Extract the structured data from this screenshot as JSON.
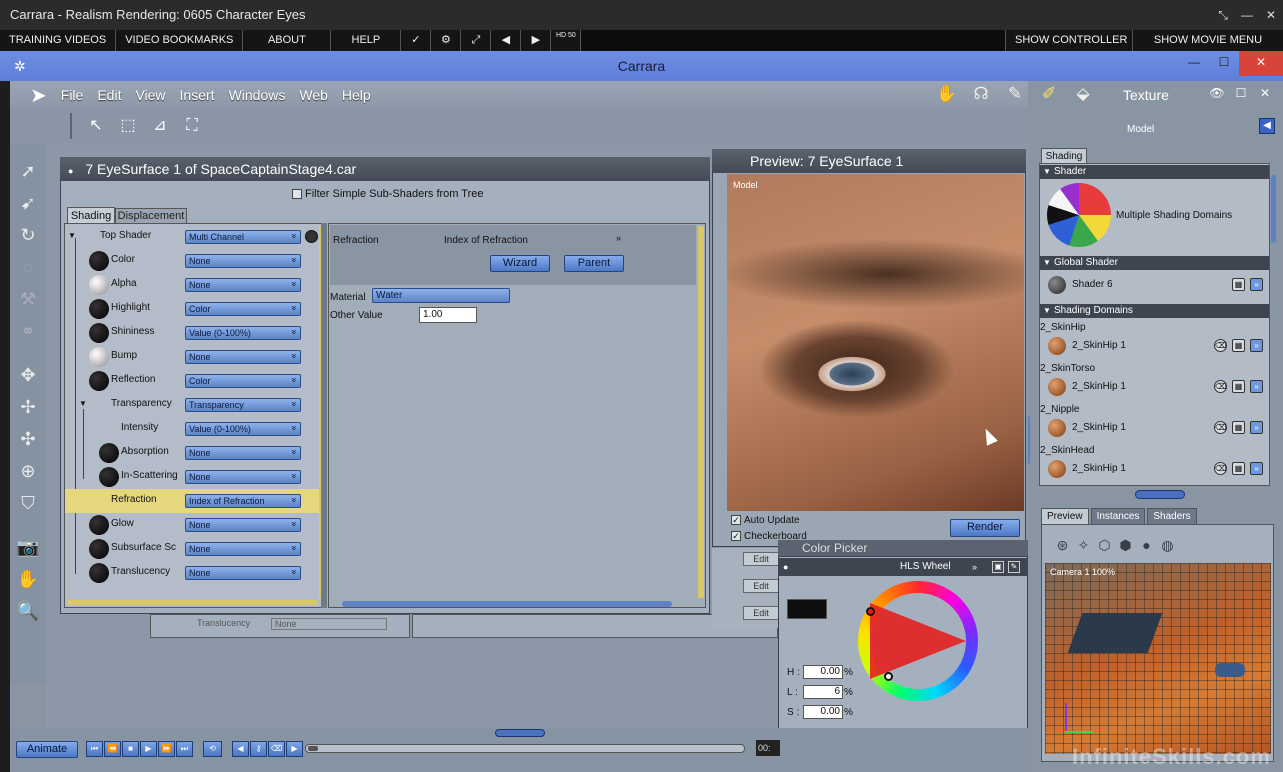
{
  "outer_window": {
    "title": "Carrara - Realism Rendering: 0605 Character Eyes"
  },
  "training_bar": {
    "items": [
      "TRAINING VIDEOS",
      "VIDEO BOOKMARKS",
      "ABOUT",
      "HELP"
    ],
    "icon_hd": "HD 50",
    "show_controller": "SHOW CONTROLLER",
    "show_movie_menu": "SHOW MOVIE MENU"
  },
  "app": {
    "title": "Carrara"
  },
  "menu": {
    "items": [
      "File",
      "Edit",
      "View",
      "Insert",
      "Windows",
      "Web",
      "Help"
    ]
  },
  "room": {
    "label": "Texture"
  },
  "shader_window": {
    "title": "7  EyeSurface 1 of SpaceCaptainStage4.car",
    "filter_label": "Filter Simple Sub-Shaders from Tree",
    "tabs": [
      "Shading",
      "Displacement"
    ],
    "tree": [
      {
        "label": "Top Shader",
        "value": "Multi Channel"
      },
      {
        "label": "Color",
        "value": "None"
      },
      {
        "label": "Alpha",
        "value": "None"
      },
      {
        "label": "Highlight",
        "value": "Color"
      },
      {
        "label": "Shininess",
        "value": "Value (0-100%)"
      },
      {
        "label": "Bump",
        "value": "None"
      },
      {
        "label": "Reflection",
        "value": "Color"
      },
      {
        "label": "Transparency",
        "value": "Transparency"
      },
      {
        "label": "Intensity",
        "value": "Value (0-100%)"
      },
      {
        "label": "Absorption",
        "value": "None"
      },
      {
        "label": "In-Scattering",
        "value": "None"
      },
      {
        "label": "Refraction",
        "value": "Index of Refraction"
      },
      {
        "label": "Glow",
        "value": "None"
      },
      {
        "label": "Subsurface Sc",
        "value": "None"
      },
      {
        "label": "Translucency",
        "value": "None"
      }
    ],
    "props": {
      "section_label": "Refraction",
      "section_value": "Index of Refraction",
      "wizard": "Wizard",
      "parent": "Parent",
      "material_label": "Material",
      "material_value": "Water",
      "other_value_label": "Other Value",
      "other_value": "1.00"
    },
    "behind_label": "Translucency",
    "behind_value": "None"
  },
  "preview_window": {
    "title": "Preview: 7  EyeSurface 1",
    "model_label": "Model",
    "auto_update": "Auto Update",
    "checkerboard": "Checkerboard",
    "render": "Render"
  },
  "edit_buttons": [
    "Edit",
    "Edit",
    "Edit"
  ],
  "color_picker": {
    "title": "Color Picker",
    "mode": "HLS Wheel",
    "swatch_color": "#0e0e0e",
    "h_label": "H :",
    "h_value": "0.00",
    "h_unit": "%",
    "l_label": "L :",
    "l_value": "6",
    "l_unit": "%",
    "s_label": "S :",
    "s_value": "0.00",
    "s_unit": "%"
  },
  "right_panel": {
    "model_label": "Model",
    "tab": "Shading",
    "shader_head": "Shader",
    "shader_name": "Multiple Shading Domains",
    "global_head": "Global Shader",
    "global_name": "Shader 6",
    "domains_head": "Shading Domains",
    "domains": [
      {
        "name": "2_SkinHip",
        "shader": "2_SkinHip 1"
      },
      {
        "name": "2_SkinTorso",
        "shader": "2_SkinHip 1"
      },
      {
        "name": "2_Nipple",
        "shader": "2_SkinHip 1"
      },
      {
        "name": "2_SkinHead",
        "shader": "2_SkinHip 1"
      }
    ],
    "bottom_tabs": [
      "Preview",
      "Instances",
      "Shaders"
    ],
    "camera_label": "Camera 1 100%"
  },
  "bottom_bar": {
    "animate": "Animate",
    "time": "00:"
  },
  "watermark": "InfiniteSkills.com"
}
